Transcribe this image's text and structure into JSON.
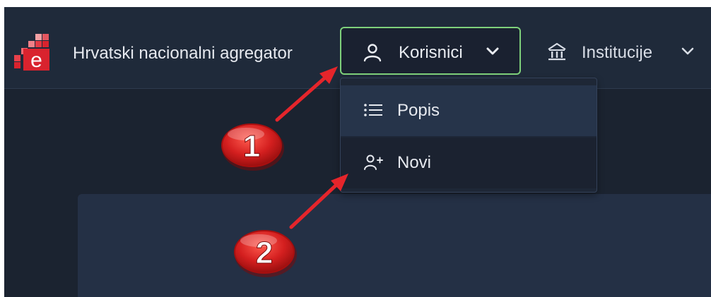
{
  "brand": {
    "name": "Hrvatski nacionalni agregator",
    "logo_letter": "e",
    "logo_color": "#d9232e"
  },
  "nav": {
    "users_label": "Korisnici",
    "users_icon": "user-icon",
    "institutions_label": "Institucije",
    "institutions_icon": "institution-icon"
  },
  "dropdown": {
    "items": [
      {
        "label": "Popis",
        "icon": "list-icon"
      },
      {
        "label": "Novi",
        "icon": "user-plus-icon"
      }
    ]
  },
  "annotations": [
    {
      "number": "1",
      "target": "Korisnici"
    },
    {
      "number": "2",
      "target": "Novi"
    }
  ],
  "colors": {
    "navbar_bg": "#1f2a3a",
    "page_bg": "#1b2330",
    "active_border": "#7fd17b",
    "hover_item": "#26344a",
    "arrow_red": "#e5252b",
    "badge_red": "#d41f1f"
  }
}
